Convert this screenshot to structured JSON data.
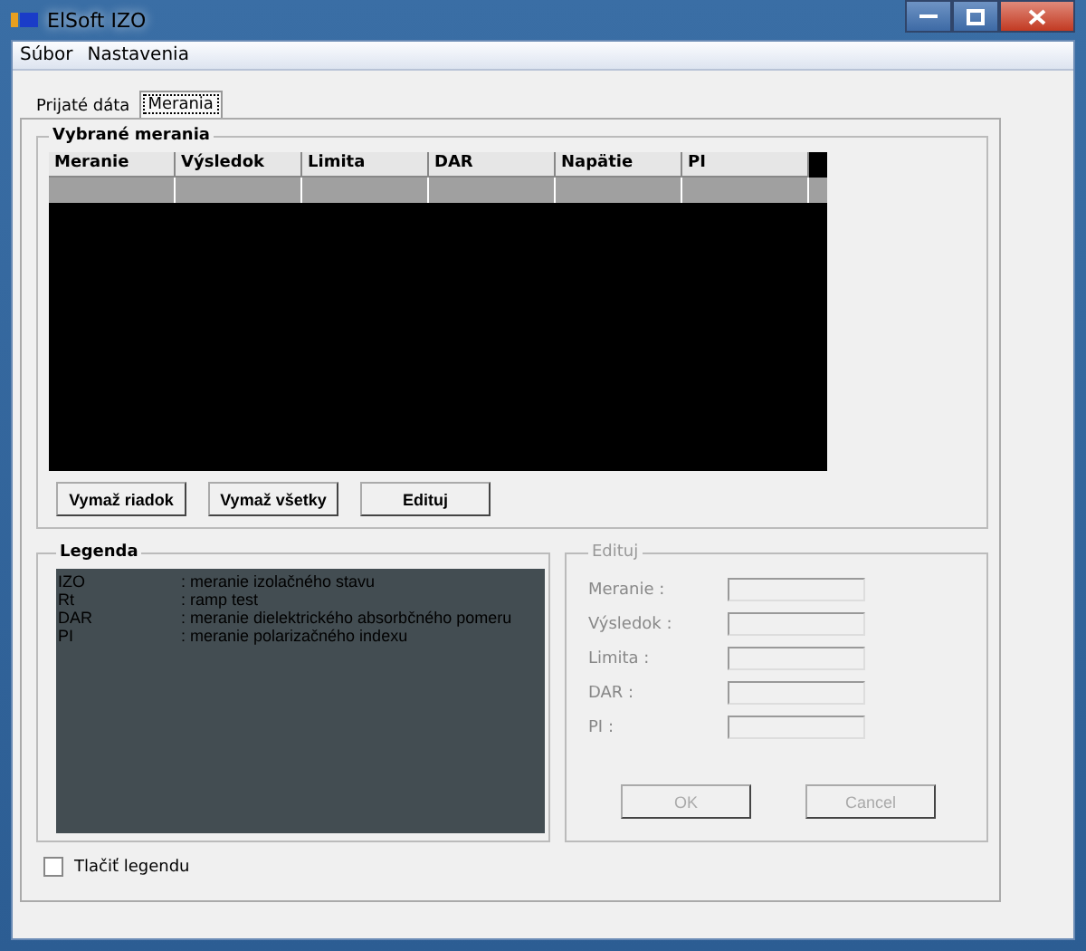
{
  "window": {
    "title": "ElSoft IZO"
  },
  "menu": [
    "Súbor",
    "Nastavenia"
  ],
  "tabs": [
    {
      "label": "Prijaté dáta",
      "selected": false
    },
    {
      "label": "Merania",
      "selected": true
    }
  ],
  "measurements": {
    "title": "Vybrané merania",
    "columns": [
      "Meranie",
      "Výsledok",
      "Limita",
      "DAR",
      "Napätie",
      "PI"
    ],
    "rows": [
      {
        "cells": [
          "",
          "",
          "",
          "",
          "",
          ""
        ],
        "selected": true
      }
    ],
    "buttons": [
      "Vymaž riadok",
      "Vymaž všetky",
      "Edituj"
    ]
  },
  "legend": {
    "title": "Legenda",
    "items": [
      {
        "code": "IZO",
        "text": ": meranie izolačného stavu"
      },
      {
        "code": "Rt",
        "text": ": ramp test"
      },
      {
        "code": "DAR",
        "text": ": meranie dielektrického absorbčného pomeru"
      },
      {
        "code": "PI",
        "text": ": meranie polarizačného indexu"
      }
    ]
  },
  "edit": {
    "title": "Edituj",
    "disabled": true,
    "fields": [
      "Meranie :",
      "Výsledok :",
      "Limita :",
      "DAR :",
      "PI :"
    ],
    "buttons": [
      "OK",
      "Cancel"
    ]
  },
  "print_legend": {
    "label": "Tlačiť legendu",
    "checked": false
  }
}
